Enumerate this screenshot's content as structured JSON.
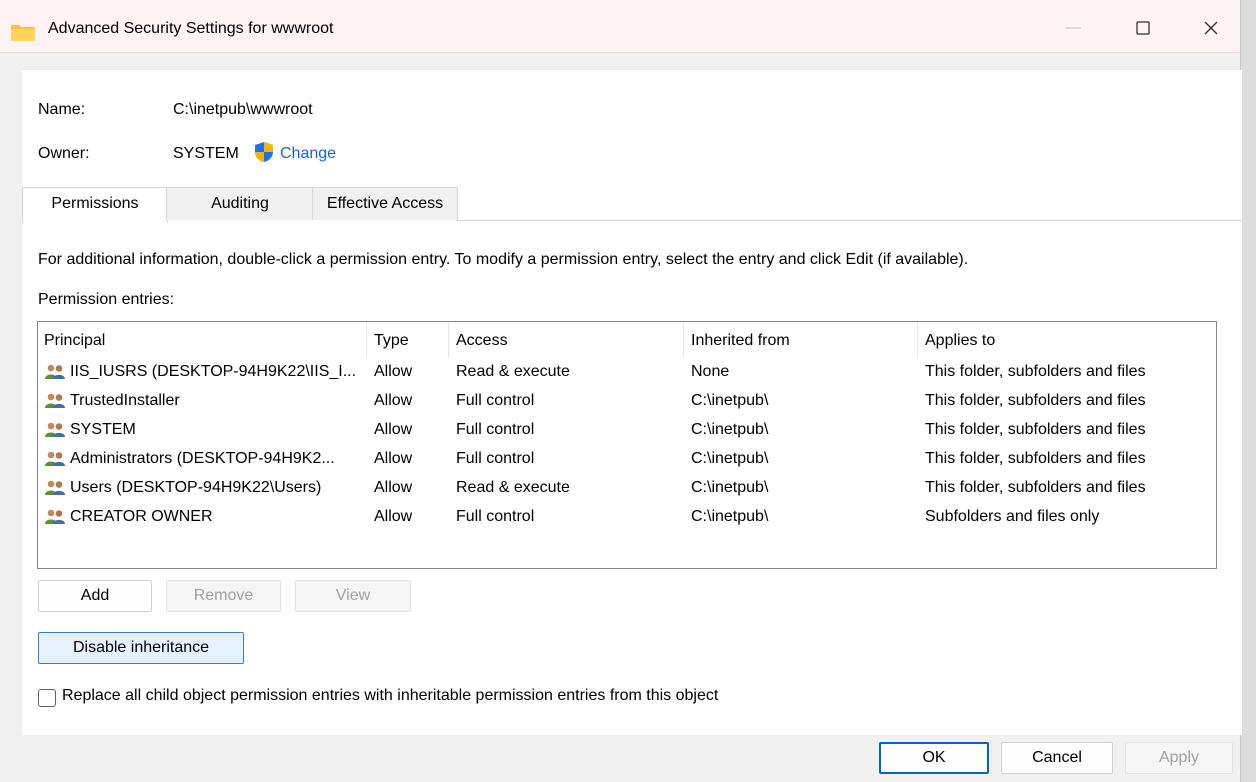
{
  "window": {
    "title": "Advanced Security Settings for wwwroot",
    "minimize_glyph": "—",
    "maximize_glyph": "☐",
    "close_glyph": "✕"
  },
  "info": {
    "name_label": "Name:",
    "name_value": "C:\\inetpub\\wwwroot",
    "owner_label": "Owner:",
    "owner_value": "SYSTEM",
    "change_link": "Change"
  },
  "tabs": [
    {
      "label": "Permissions",
      "active": true
    },
    {
      "label": "Auditing",
      "active": false
    },
    {
      "label": "Effective Access",
      "active": false
    }
  ],
  "instructions": "For additional information, double-click a permission entry. To modify a permission entry, select the entry and click Edit (if available).",
  "entries_label": "Permission entries:",
  "table": {
    "columns": [
      "Principal",
      "Type",
      "Access",
      "Inherited from",
      "Applies to"
    ],
    "rows": [
      {
        "principal": "IIS_IUSRS (DESKTOP-94H9K22\\IIS_I...",
        "type": "Allow",
        "access": "Read & execute",
        "inherited": "None",
        "applies": "This folder, subfolders and files"
      },
      {
        "principal": "TrustedInstaller",
        "type": "Allow",
        "access": "Full control",
        "inherited": "C:\\inetpub\\",
        "applies": "This folder, subfolders and files"
      },
      {
        "principal": "SYSTEM",
        "type": "Allow",
        "access": "Full control",
        "inherited": "C:\\inetpub\\",
        "applies": "This folder, subfolders and files"
      },
      {
        "principal": "Administrators (DESKTOP-94H9K2...",
        "type": "Allow",
        "access": "Full control",
        "inherited": "C:\\inetpub\\",
        "applies": "This folder, subfolders and files"
      },
      {
        "principal": "Users (DESKTOP-94H9K22\\Users)",
        "type": "Allow",
        "access": "Read & execute",
        "inherited": "C:\\inetpub\\",
        "applies": "This folder, subfolders and files"
      },
      {
        "principal": "CREATOR OWNER",
        "type": "Allow",
        "access": "Full control",
        "inherited": "C:\\inetpub\\",
        "applies": "Subfolders and files only"
      }
    ]
  },
  "buttons": {
    "add": "Add",
    "remove": "Remove",
    "view": "View",
    "disable_inheritance": "Disable inheritance",
    "ok": "OK",
    "cancel": "Cancel",
    "apply": "Apply"
  },
  "replace_checkbox": {
    "label": "Replace all child object permission entries with inheritable permission entries from this object",
    "checked": false
  },
  "icons": {
    "title": "folder-icon",
    "owner": "uac-shield-icon",
    "principal": "users-group-icon"
  },
  "colors": {
    "link": "#1a64c8",
    "titlebar": "#fdf3f2",
    "accent_button": "#e5f1fb",
    "default_border": "#0067c0"
  }
}
